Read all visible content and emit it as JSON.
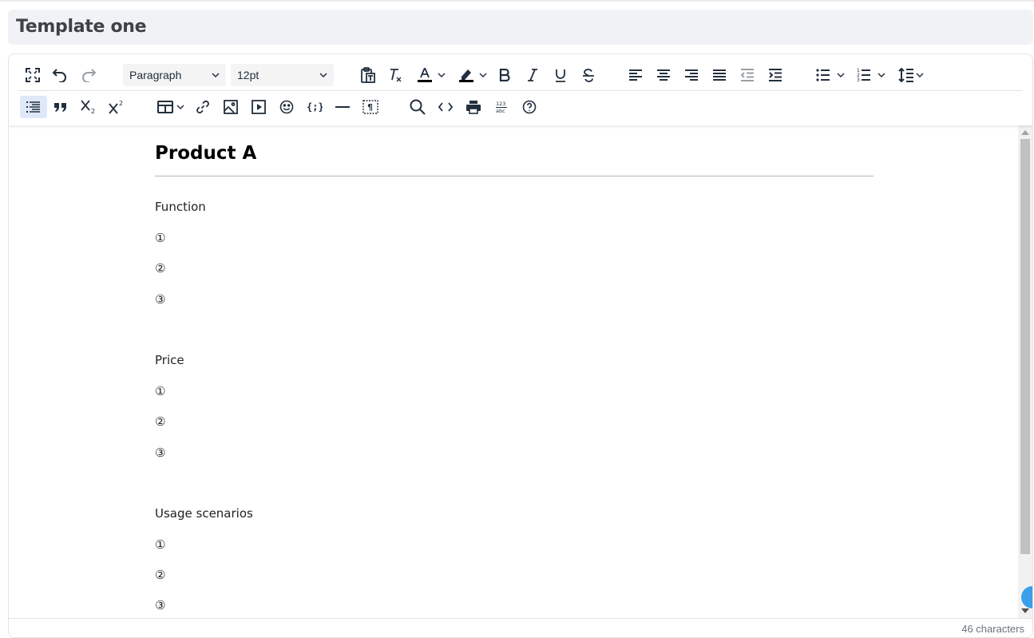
{
  "page": {
    "title": "Template one"
  },
  "toolbar": {
    "block_format": "Paragraph",
    "font_size": "12pt",
    "font_color": "#000000",
    "highlight_color": "#000000",
    "row1_icons": [
      "fullscreen-icon",
      "undo-icon",
      "redo-icon",
      "paste-text-icon",
      "clear-format-icon",
      "font-color-icon",
      "highlight-icon",
      "bold-icon",
      "italic-icon",
      "underline-icon",
      "strikethrough-icon",
      "align-left-icon",
      "align-center-icon",
      "align-right-icon",
      "justify-icon",
      "outdent-icon",
      "indent-icon",
      "bullet-list-icon",
      "numbered-list-icon",
      "line-height-icon"
    ],
    "row2_icons": [
      "toc-icon",
      "blockquote-icon",
      "subscript-icon",
      "superscript-icon",
      "table-icon",
      "link-icon",
      "image-icon",
      "media-icon",
      "emoji-icon",
      "code-sample-icon",
      "horizontal-rule-icon",
      "visual-blocks-icon",
      "search-icon",
      "source-code-icon",
      "print-icon",
      "word-count-icon",
      "help-icon"
    ]
  },
  "document": {
    "heading": "Product A",
    "sections": [
      {
        "label": "Function",
        "items": [
          "①",
          "②",
          "③"
        ]
      },
      {
        "label": "Price",
        "items": [
          "①",
          "②",
          "③"
        ]
      },
      {
        "label": "Usage scenarios",
        "items": [
          "①",
          "②",
          "③"
        ]
      }
    ]
  },
  "status": {
    "char_count": "46 characters"
  },
  "colors": {
    "accent": "#3a9ee8",
    "active_button_bg": "#dee8f8",
    "title_bar_bg": "#f1f2f5"
  }
}
